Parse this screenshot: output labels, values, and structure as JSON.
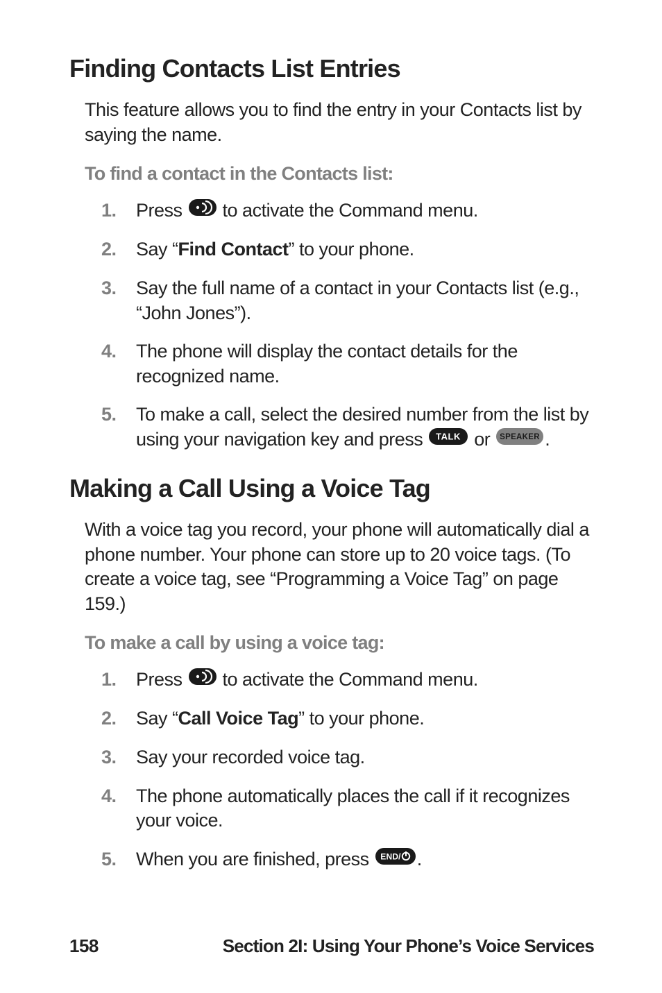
{
  "sectionA": {
    "heading": "Finding Contacts List Entries",
    "intro": "This feature allows you to find the entry in your Contacts list by saying the name.",
    "subhead": "To find a contact in the Contacts list:",
    "steps": {
      "s1a": "Press ",
      "s1b": " to activate the Command menu.",
      "s2a": "Say “",
      "s2bold": "Find Contact",
      "s2b": "” to your phone.",
      "s3": "Say the full name of a contact in your Contacts list (e.g., “John Jones”).",
      "s4": "The phone will display the contact details for the recognized name.",
      "s5a": "To make a call, select the desired number from the list by using your navigation key and press ",
      "s5b": " or ",
      "s5c": "."
    }
  },
  "sectionB": {
    "heading": "Making a Call Using a Voice Tag",
    "intro": "With a voice tag you record, your phone will automatically dial a phone number. Your phone can store up to 20 voice tags. (To create a voice tag, see “Programming a Voice Tag” on page 159.)",
    "subhead": "To make a call by using a voice tag:",
    "steps": {
      "s1a": "Press ",
      "s1b": " to activate the Command menu.",
      "s2a": "Say “",
      "s2bold": "Call Voice Tag",
      "s2b": "” to your phone.",
      "s3": "Say your recorded voice tag.",
      "s4": "The phone automatically places the call if it recognizes your voice.",
      "s5a": "When you are finished, press ",
      "s5b": "."
    }
  },
  "footer": {
    "page": "158",
    "text": "Section 2I: Using Your Phone’s Voice Services"
  },
  "icons": {
    "voice": "voice-key-icon",
    "talk": "talk-key-icon",
    "speaker": "speaker-key-icon",
    "end": "end-key-icon"
  }
}
